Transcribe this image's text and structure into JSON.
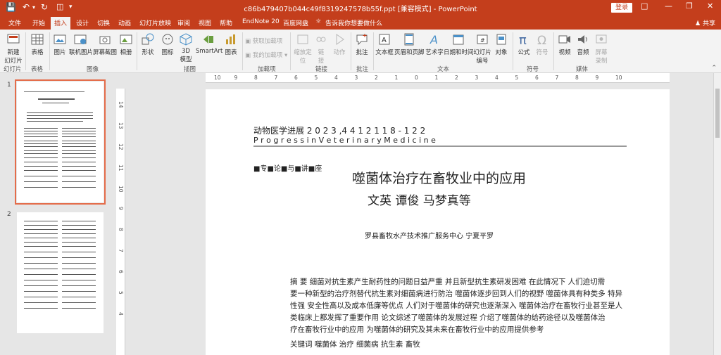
{
  "window": {
    "title": "c86b479407b044c49f8319247578b55f.ppt [兼容模式] - PowerPoint",
    "login_label": "登录"
  },
  "tabs": {
    "file": "文件",
    "home": "开始",
    "insert": "插入",
    "design": "设计",
    "transitions": "切换",
    "animations": "动画",
    "slideshow": "幻灯片放映",
    "review": "审阅",
    "view": "视图",
    "help": "帮助",
    "endnote": "EndNote 20",
    "baidu": "百度网盘",
    "tellme": "告诉我你想要做什么",
    "share": "共享"
  },
  "ribbon": {
    "new_slide": "新建",
    "new_slide_2": "幻灯片",
    "table": "表格",
    "picture": "图片",
    "online_picture": "联机图片",
    "screenshot": "屏幕截图",
    "album": "相册",
    "shapes": "形状",
    "icons": "图标",
    "model3d": "3D",
    "model3d_2": "模型",
    "smartart": "SmartArt",
    "chart": "图表",
    "get_addins": "获取加载项",
    "my_addins": "我的加载项",
    "zoom": "缩放定",
    "zoom_2": "位",
    "link": "链",
    "link_2": "接",
    "action": "动作",
    "comment": "批注",
    "textbox": "文本框",
    "header_footer": "页眉和页脚",
    "wordart": "艺术字",
    "datetime": "日期和时间",
    "slide_number": "幻灯片",
    "slide_number_2": "编号",
    "object": "对象",
    "equation": "公式",
    "symbol": "符号",
    "video": "视频",
    "audio": "音频",
    "screen_record": "屏幕",
    "screen_record_2": "录制",
    "groups": {
      "slides": "幻灯片",
      "tables": "表格",
      "images": "图像",
      "illustrations": "插图",
      "addins": "加载项",
      "links": "链接",
      "comments": "批注",
      "text": "文本",
      "symbols": "符号",
      "media": "媒体"
    }
  },
  "thumbnails": {
    "slide1_number": "1",
    "slide2_number": "2"
  },
  "ruler": {
    "h_ticks": [
      "10",
      "9",
      "8",
      "7",
      "6",
      "5",
      "4",
      "3",
      "2",
      "1",
      "0",
      "1",
      "2",
      "3",
      "4",
      "5",
      "6",
      "7",
      "8",
      "9",
      "10"
    ],
    "v_ticks": [
      "14",
      "13",
      "12",
      "11",
      "10",
      "9",
      "8",
      "7",
      "6",
      "5",
      "4"
    ]
  },
  "slide": {
    "journal_line": "动物医学进展 2 0 2 3 ,4 4 1 2 1 1 8 - 1 2 2",
    "journal_en": "P r o g r e s s  i n  V e t e r i n a r y  M e d i c i n e",
    "column_tag": "■专■论■与■讲■座",
    "title": "噬菌体治疗在畜牧业中的应用",
    "authors": "文英 谭俊 马梦真等",
    "affiliation": "罗县畜牧水产技术推广服务中心 宁夏平罗",
    "abstract_lines": [
      "摘  要  细菌对抗生素产生耐药性的问题日益严重  并且新型抗生素研发困难  在此情况下  人们迫切需",
      "要一种新型的治疗剂替代抗生素对细菌病进行防治  噬菌体逐步回到人们的视野  噬菌体具有种类多  特异",
      "性强  安全性高以及成本低廉等优点  人们对于噬菌体的研究也逐渐深入  噬菌体治疗在畜牧行业甚至是人",
      "类临床上都发挥了重要作用  论文综述了噬菌体的发展过程  介绍了噬菌体的给药途径以及噬菌体治",
      "疗在畜牧行业中的应用  为噬菌体的研究及其未来在畜牧行业中的应用提供参考"
    ],
    "keywords": "关键词  噬菌体  治疗  细菌病  抗生素  畜牧"
  }
}
